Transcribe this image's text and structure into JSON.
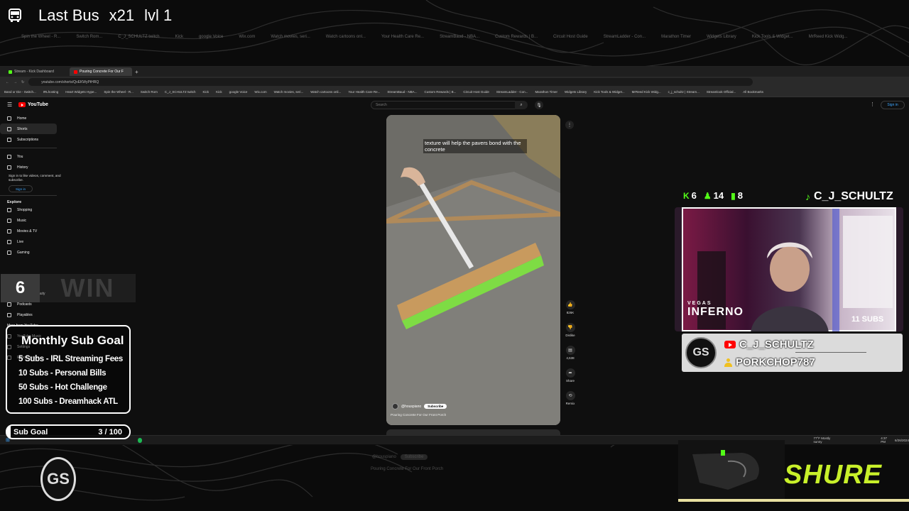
{
  "overlay": {
    "title": "Last Bus",
    "multiplier": "x21",
    "level": "lvl 1"
  },
  "ghost_bookmarks": [
    "Spin the Wheel - R...",
    "Switch Rom...",
    "C_J_SCHULTZ twitch",
    "Kick",
    "google Voice",
    "Wix.com",
    "Watch movies, seri...",
    "Watch cartoons onl...",
    "Your Health Care Re...",
    "StreamBaud - NBA...",
    "Custom Rewards | B...",
    "Circuit Host Guide",
    "StreamLadder - Con...",
    "Marathon Timer",
    "Widgets Library",
    "Kick Tools & Widget...",
    "MrReed Kick Widg..."
  ],
  "browser": {
    "tabs": [
      {
        "label": "Stream - Kick Dashboard",
        "active": false
      },
      {
        "label": "Pouring Concrete For Our F",
        "active": true
      }
    ],
    "url": "youtube.com/shorts/QvEKWyPtHRQ",
    "bookmarks": [
      "Band or Die - Switch...",
      "IRLhosting",
      "Heart Widgets Hype...",
      "Spin the Wheel - R...",
      "Switch Rom",
      "C_J_SCHULTZ twitch",
      "Kick",
      "Kick",
      "google Voice",
      "Wix.com",
      "Watch movies, seri...",
      "Watch cartoons onli...",
      "Your Health Care Re...",
      "StreamBaud - NBA...",
      "Custom Rewards | B...",
      "Circuit Host Guide",
      "StreamLadder - Con...",
      "Marathon Timer",
      "Widgets Library",
      "Kick Tools & Widget...",
      "MrReed Kick Widg...",
      "c_j_schultz | Stream...",
      "Streamlook Official...",
      "All Bookmarks"
    ]
  },
  "youtube": {
    "logo": "YouTube",
    "search_placeholder": "Search",
    "sign_in": "Sign in",
    "sidebar": {
      "top": [
        "Home",
        "Shorts",
        "Subscriptions"
      ],
      "you": [
        "You",
        "History"
      ],
      "signin_prompt": "Sign in to like videos, comment, and subscribe.",
      "signin_button": "Sign in",
      "explore_heading": "Explore",
      "explore": [
        "Shopping",
        "Music",
        "Movies & TV",
        "Live",
        "Gaming"
      ],
      "more": [
        "Fashion & Beauty",
        "Podcasts",
        "Playables"
      ],
      "more_heading": "More from YouTube",
      "misc": [
        "YouTube Music",
        "Settings",
        "Report history"
      ]
    },
    "short": {
      "caption": "texture will help the pavers bond with the concrete",
      "channel": "@houspiano",
      "subscribe": "Subscribe",
      "title": "Pouring Concrete For Our Front Porch"
    },
    "actions": [
      {
        "name": "like",
        "count": "826K"
      },
      {
        "name": "dislike",
        "count": "Dislike"
      },
      {
        "name": "comments",
        "count": "4,638"
      },
      {
        "name": "share",
        "count": "Share"
      },
      {
        "name": "remix",
        "count": "Remix"
      }
    ]
  },
  "taskbar": {
    "weather": "77°F Mostly sunny",
    "time": "4:37 PM",
    "date": "6/26/2024"
  },
  "wins": {
    "count": "6",
    "label": "WIN"
  },
  "sub_goal_panel": {
    "title": "Monthly Sub Goal",
    "items": [
      "5 Subs - IRL Streaming Fees",
      "10 Subs - Personal Bills",
      "50 Subs - Hot Challenge",
      "100 Subs - Dreamhack ATL"
    ]
  },
  "sub_goal_bar": {
    "label": "Sub Goal",
    "count": "3 / 100",
    "progress": 0.03
  },
  "cam_stats": {
    "kick": "6",
    "viewers": "14",
    "bars": "8",
    "username": "C_J_SCHULTZ"
  },
  "cam_overlay": {
    "vegas": "VEGAS",
    "inferno": "INFERNO",
    "subs": "11 SUBS"
  },
  "socials": {
    "logo": "GS",
    "youtube": "C_J_SCHULTZ",
    "user": "PORKCHOP787"
  },
  "bottom_logo": "GS",
  "sponsor": "SHURE",
  "colors": {
    "kick_green": "#53fc18",
    "youtube_red": "#ff0000",
    "shure_yellow": "#c8f02a"
  }
}
